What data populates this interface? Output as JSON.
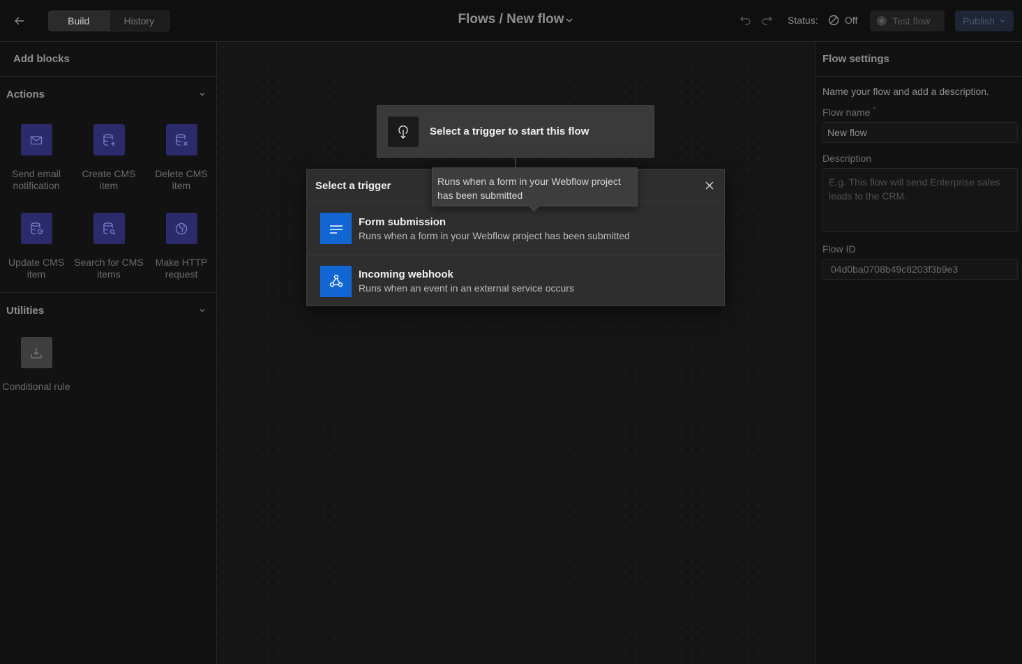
{
  "topbar": {
    "tabs": [
      {
        "label": "Build",
        "active": true
      },
      {
        "label": "History",
        "active": false
      }
    ],
    "title": "Flows / New flow",
    "status_label": "Status:",
    "status_value": "Off",
    "test_label": "Test flow",
    "publish_label": "Publish"
  },
  "left_panel": {
    "header": "Add blocks",
    "sections": [
      {
        "title": "Actions",
        "items": [
          {
            "label": "Send email notification",
            "icon": "mail-icon"
          },
          {
            "label": "Create CMS item",
            "icon": "database-plus-icon"
          },
          {
            "label": "Delete CMS item",
            "icon": "database-x-icon"
          },
          {
            "label": "Update CMS item",
            "icon": "database-refresh-icon"
          },
          {
            "label": "Search for CMS items",
            "icon": "database-search-icon"
          },
          {
            "label": "Make HTTP request",
            "icon": "globe-icon"
          }
        ]
      },
      {
        "title": "Utilities",
        "items": [
          {
            "label": "Conditional rule",
            "icon": "branch-icon"
          }
        ]
      }
    ]
  },
  "canvas": {
    "trigger_card_text": "Select a trigger to start this flow",
    "modal": {
      "title": "Select a trigger",
      "options": [
        {
          "title": "Form submission",
          "description": "Runs when a form in your Webflow project has been submitted",
          "icon": "form-lines-icon"
        },
        {
          "title": "Incoming webhook",
          "description": "Runs when an event in an external service occurs",
          "icon": "webhook-icon"
        }
      ]
    },
    "tooltip": "Runs when a form in your Webflow project has been submitted"
  },
  "right_panel": {
    "header": "Flow settings",
    "intro": "Name your flow and add a description.",
    "flow_name_label": "Flow name",
    "flow_name_required": "*",
    "flow_name_value": "New flow",
    "description_label": "Description",
    "description_placeholder": "E.g. This flow will send Enterprise sales leads to the CRM.",
    "flow_id_label": "Flow ID",
    "flow_id_value": "04d0ba0708b49c8203f3b9e3"
  },
  "colors": {
    "accent_blue": "#1266d4",
    "action_block": "#2b2a6b",
    "background": "#141414"
  }
}
